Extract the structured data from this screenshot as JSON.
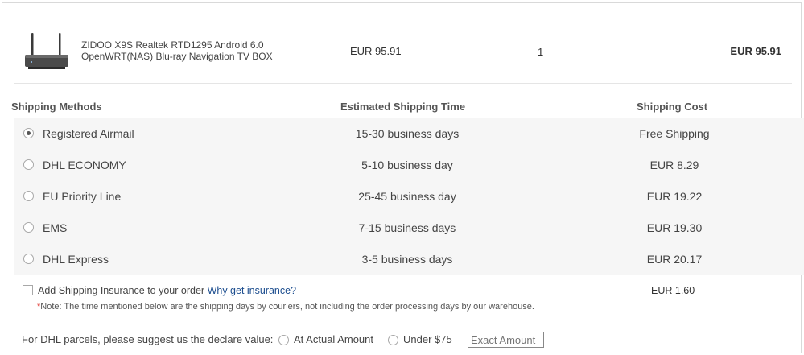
{
  "product": {
    "image_icon": "tv-box-icon",
    "title_line1": "ZIDOO X9S Realtek RTD1295 Android 6.0",
    "title_line2": "OpenWRT(NAS) Blu-ray Navigation TV BOX",
    "price": "EUR 95.91",
    "quantity": "1",
    "total": "EUR 95.91"
  },
  "shipping": {
    "headers": {
      "method": "Shipping Methods",
      "time": "Estimated Shipping Time",
      "cost": "Shipping Cost"
    },
    "methods": [
      {
        "name": "Registered Airmail",
        "time": "15-30 business days",
        "cost": "Free Shipping",
        "selected": true
      },
      {
        "name": "DHL ECONOMY",
        "time": "5-10 business day",
        "cost": "EUR 8.29",
        "selected": false
      },
      {
        "name": "EU Priority Line",
        "time": "25-45 business day",
        "cost": "EUR 19.22",
        "selected": false
      },
      {
        "name": "EMS",
        "time": "7-15 business days",
        "cost": "EUR 19.30",
        "selected": false
      },
      {
        "name": "DHL Express",
        "time": "3-5 business days",
        "cost": "EUR 20.17",
        "selected": false
      }
    ]
  },
  "insurance": {
    "label": "Add Shipping Insurance to your order",
    "link": "Why get insurance?",
    "cost": "EUR 1.60",
    "checked": false
  },
  "note": {
    "star": "*",
    "text": "Note: The time mentioned below are the shipping days by couriers, not including the order processing days by our warehouse."
  },
  "dhl_declare": {
    "label": "For DHL parcels, please suggest us the declare value:",
    "option_actual": "At Actual Amount",
    "option_under": "Under $75",
    "exact_placeholder": "Exact Amount"
  }
}
